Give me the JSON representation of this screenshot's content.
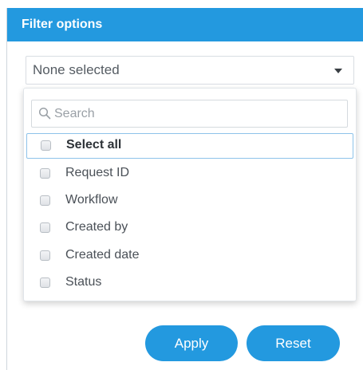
{
  "panel": {
    "title": "Filter options"
  },
  "select": {
    "value": "None selected"
  },
  "search": {
    "placeholder": "Search"
  },
  "options": [
    {
      "label": "Select all",
      "checked": false
    },
    {
      "label": "Request ID",
      "checked": false
    },
    {
      "label": "Workflow",
      "checked": false
    },
    {
      "label": "Created by",
      "checked": false
    },
    {
      "label": "Created date",
      "checked": false
    },
    {
      "label": "Status",
      "checked": false
    }
  ],
  "buttons": {
    "apply": "Apply",
    "reset": "Reset"
  },
  "colors": {
    "accent": "#2399df",
    "focus_border": "#8ec3ea"
  }
}
